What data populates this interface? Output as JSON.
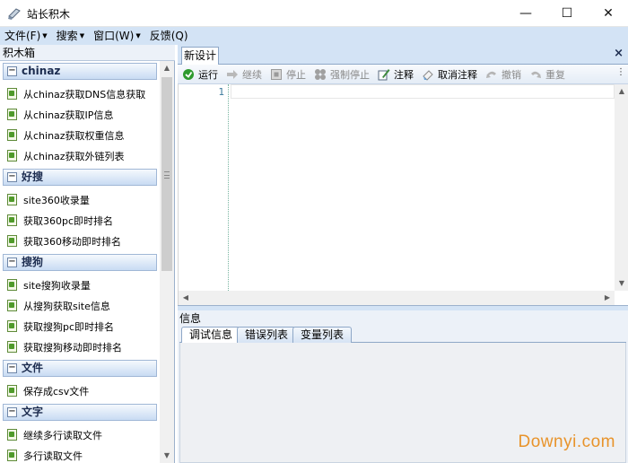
{
  "window": {
    "title": "站长积木",
    "min_label": "—",
    "max_label": "☐",
    "close_label": "✕"
  },
  "menu": [
    {
      "label": "文件(F)",
      "has_caret": true
    },
    {
      "label": "搜索",
      "has_caret": true
    },
    {
      "label": "窗口(W)",
      "has_caret": true
    },
    {
      "label": "反馈(Q)",
      "has_caret": false
    }
  ],
  "toolbox": {
    "title": "积木箱",
    "groups": [
      {
        "title": "chinaz",
        "items": [
          "从chinaz获取DNS信息获取",
          "从chinaz获取IP信息",
          "从chinaz获取权重信息",
          "从chinaz获取外链列表"
        ]
      },
      {
        "title": "好搜",
        "items": [
          "site360收录量",
          "获取360pc即时排名",
          "获取360移动即时排名"
        ]
      },
      {
        "title": "搜狗",
        "items": [
          "site搜狗收录量",
          "从搜狗获取site信息",
          "获取搜狗pc即时排名",
          "获取搜狗移动即时排名"
        ]
      },
      {
        "title": "文件",
        "items": [
          "保存成csv文件"
        ]
      },
      {
        "title": "文字",
        "items": [
          "继续多行读取文件",
          "多行读取文件"
        ]
      }
    ]
  },
  "editor": {
    "tab_label": "新设计",
    "tab_close": "×",
    "line_number": "1",
    "toolbar": [
      {
        "label": "运行",
        "icon": "run-icon",
        "enabled": true
      },
      {
        "label": "继续",
        "icon": "continue-icon",
        "enabled": false
      },
      {
        "label": "停止",
        "icon": "stop-icon",
        "enabled": false
      },
      {
        "label": "强制停止",
        "icon": "force-stop-icon",
        "enabled": false
      },
      {
        "label": "注释",
        "icon": "comment-icon",
        "enabled": true
      },
      {
        "label": "取消注释",
        "icon": "uncomment-icon",
        "enabled": true
      },
      {
        "label": "撤销",
        "icon": "undo-icon",
        "enabled": false
      },
      {
        "label": "重复",
        "icon": "redo-icon",
        "enabled": false
      }
    ]
  },
  "info": {
    "title": "信息",
    "tabs": [
      "调试信息",
      "错误列表",
      "变量列表"
    ]
  },
  "watermark": "Downyi.com",
  "colors": {
    "menu_bg": "#d3e3f5",
    "run_green": "#2e9a2e",
    "watermark": "#e8932a"
  }
}
